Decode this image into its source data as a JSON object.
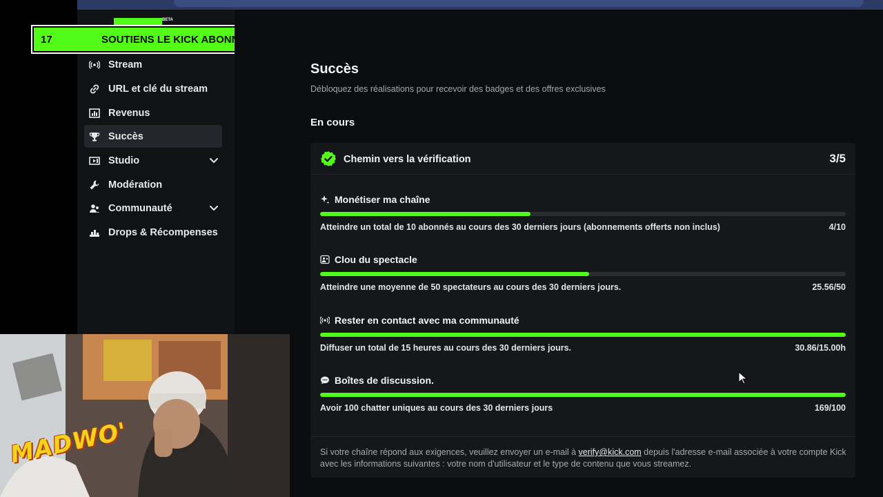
{
  "banner": {
    "count": "17",
    "text": "SOUTIENS LE KICK ABONNE TOI"
  },
  "logo": {
    "beta": "BETA"
  },
  "sidebar": {
    "items": [
      {
        "label": "Stream",
        "icon": "broadcast-icon",
        "active": false
      },
      {
        "label": "URL et clé du stream",
        "icon": "link-icon",
        "active": false
      },
      {
        "label": "Revenus",
        "icon": "bar-chart-icon",
        "active": false
      },
      {
        "label": "Succès",
        "icon": "trophy-icon",
        "active": true
      },
      {
        "label": "Studio",
        "icon": "studio-icon",
        "active": false,
        "expandable": true
      },
      {
        "label": "Modération",
        "icon": "wrench-icon",
        "active": false
      },
      {
        "label": "Communauté",
        "icon": "users-icon",
        "active": false,
        "expandable": true
      },
      {
        "label": "Drops & Récompenses",
        "icon": "gift-icon",
        "active": false
      }
    ]
  },
  "main": {
    "title": "Succès",
    "subtitle": "Débloquez des réalisations pour recevoir des badges et des offres exclusives",
    "section_title": "En cours",
    "card": {
      "title": "Chemin vers la vérification",
      "progress": "3/5",
      "achievements": [
        {
          "title": "Monétiser ma chaîne",
          "icon": "sparkle-icon",
          "desc": "Atteindre un total de 10 abonnés au cours des 30 derniers jours (abonnements offerts non inclus)",
          "value": "4/10",
          "progress": 0.4
        },
        {
          "title": "Clou du spectacle",
          "icon": "users-icon",
          "desc": "Atteindre une moyenne de 50 spectateurs au cours des 30 derniers jours.",
          "value": "25.56/50",
          "progress": 0.5112
        },
        {
          "title": "Rester en contact avec ma communauté",
          "icon": "broadcast-icon",
          "desc": "Diffuser un total de 15 heures au cours des 30 derniers jours.",
          "value": "30.86/15.00h",
          "progress": 1.0
        },
        {
          "title": "Boîtes de discussion.",
          "icon": "chat-icon",
          "desc": "Avoir 100 chatter uniques au cours des 30 derniers jours",
          "value": "169/100",
          "progress": 1.0
        }
      ],
      "footer": {
        "before": "Si votre chaîne répond aux exigences, veuillez envoyer un e-mail à ",
        "link": "verify@kick.com",
        "after": " depuis l'adresse e-mail associée à votre compte Kick avec les informations suivantes : votre nom d'utilisateur et le type de contenu que vous streamez."
      }
    }
  },
  "webcam": {
    "watermark": "MADWO'"
  },
  "colors": {
    "accent": "#53fc18",
    "background": "#0b0c0d",
    "sidebar": "#111214",
    "card": "#16171a"
  }
}
